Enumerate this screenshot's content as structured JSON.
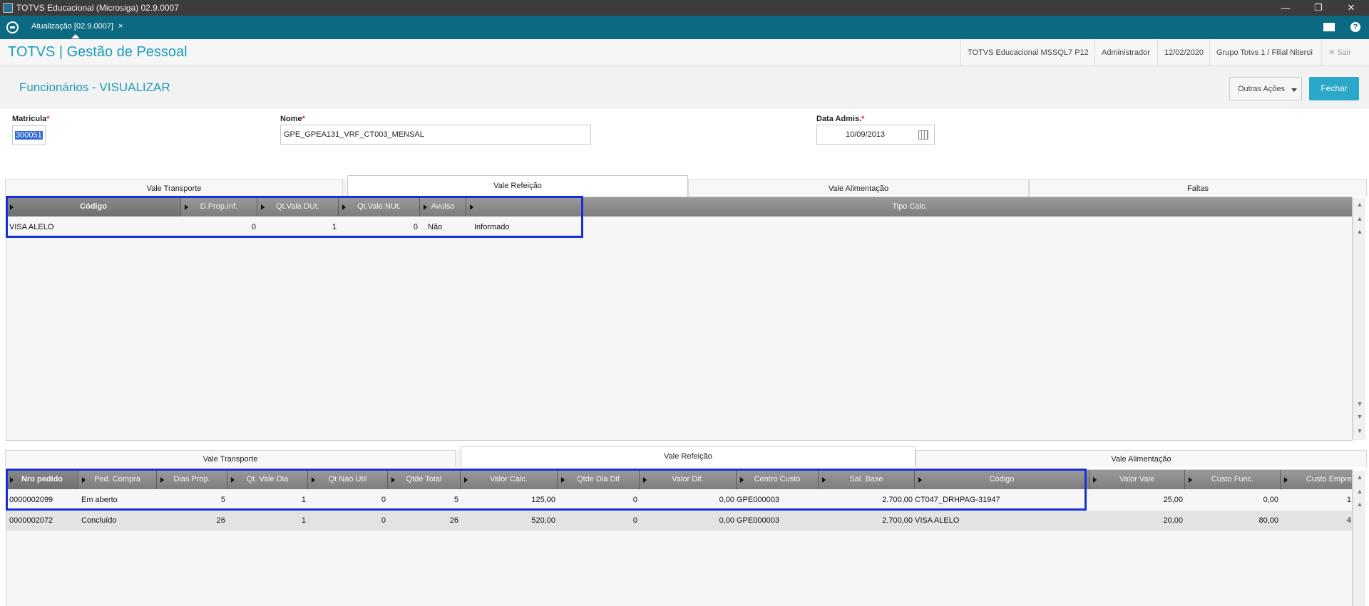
{
  "window": {
    "title": "TOTVS Educacional (Microsiga) 02.9.0007",
    "controls": [
      "—",
      "❐",
      "✕"
    ]
  },
  "tabbar": {
    "tab_label": "Atualização [02.9.0007]",
    "tab_close": "×",
    "help": "?"
  },
  "header": {
    "brand": "TOTVS | Gestão de Pessoal",
    "environment": "TOTVS Educacional MSSQL7 P12",
    "user": "Administrador",
    "date": "12/02/2020",
    "branch": "Grupo Totvs 1 / Filial Niteroi",
    "exit": "✕  Sair"
  },
  "page": {
    "title": "Funcionários - VISUALIZAR",
    "outras_acoes": "Outras Ações",
    "fechar": "Fechar"
  },
  "form": {
    "matricula_label": "Matricula",
    "matricula_value": "300051",
    "nome_label": "Nome",
    "nome_value": "GPE_GPEA131_VRF_CT003_MENSAL",
    "data_label": "Data Admis.",
    "data_value": "10/09/2013",
    "required_mark": "*"
  },
  "top_tabs": [
    "Vale Transporte",
    "Vale Refeição",
    "Vale Alimentação",
    "Faltas"
  ],
  "top_grid": {
    "columns": [
      "Código",
      "D.Prop.Inf.",
      "Qt.Vale.DUt.",
      "Qt.Vale.NUt.",
      "Avulso",
      "Tipo Calc."
    ],
    "rows": [
      [
        "VISA ALELO",
        "0",
        "1",
        "0",
        "Não",
        "Informado"
      ]
    ]
  },
  "bottom_tabs": [
    "Vale Transporte",
    "Vale Refeição",
    "Vale Alimentação"
  ],
  "bottom_grid": {
    "columns": [
      "Nro pedido",
      "Ped. Compra",
      "Dias Prop.",
      "Qt. Vale Dia",
      "Qt Nao Util",
      "Qtde Total",
      "Valor Calc.",
      "Qtde Dia Dif",
      "Valor Dif.",
      "Centro Custo",
      "Sal. Base",
      "Código",
      "Valor Vale",
      "Custo Func.",
      "Custo Empre"
    ],
    "rows": [
      [
        "0000002099",
        "Em aberto",
        "5",
        "1",
        "0",
        "5",
        "125,00",
        "0",
        "0,00",
        "GPE000003",
        "2.700,00",
        "CT047_DRHPAG-31947",
        "25,00",
        "0,00",
        "1"
      ],
      [
        "0000002072",
        "Concluído",
        "26",
        "1",
        "0",
        "26",
        "520,00",
        "0",
        "0,00",
        "GPE000003",
        "2.700,00",
        "VISA ALELO",
        "20,00",
        "80,00",
        "4"
      ]
    ]
  },
  "colors": {
    "teal_bar": "#0b6a82",
    "brand_blue": "#1c9cb7",
    "button_primary": "#2aa7c9",
    "highlight_box": "#1530d8"
  }
}
